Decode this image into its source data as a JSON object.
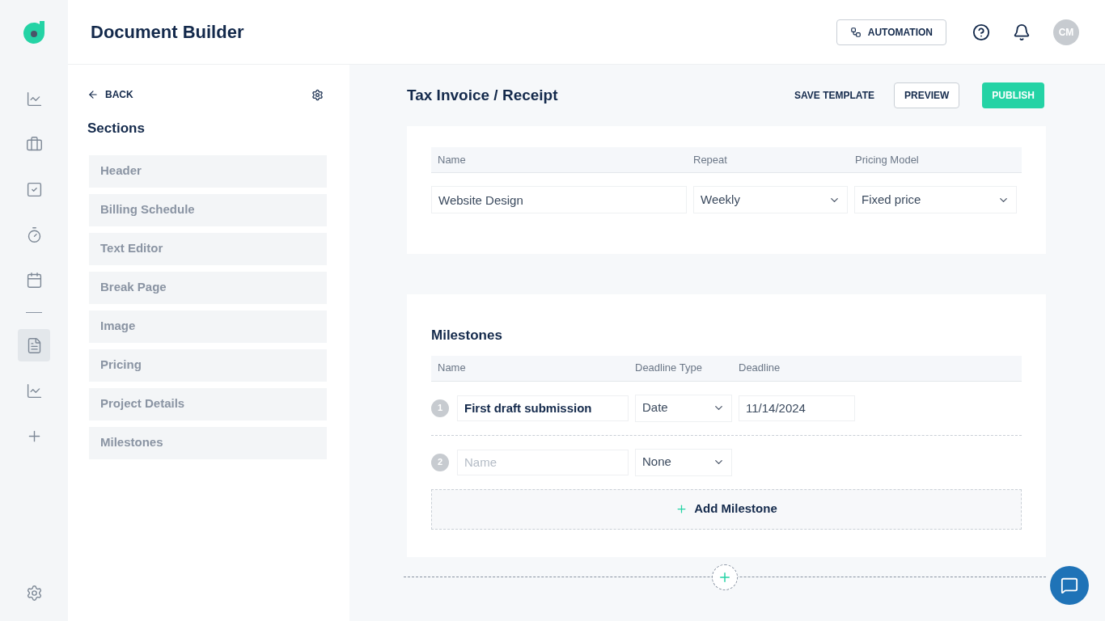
{
  "app": {
    "title": "Document Builder"
  },
  "nav": [
    {
      "kind": "chart",
      "selected": false
    },
    {
      "kind": "briefcase",
      "selected": false
    },
    {
      "kind": "checklist",
      "selected": false
    },
    {
      "kind": "timer",
      "selected": false
    },
    {
      "kind": "calendar",
      "selected": false
    },
    {
      "kind": "divider"
    },
    {
      "kind": "document",
      "selected": true
    },
    {
      "kind": "chart",
      "selected": false
    },
    {
      "kind": "plus",
      "selected": false
    }
  ],
  "header": {
    "automation": "AUTOMATION",
    "avatar": "CM"
  },
  "sections_panel": {
    "back": "BACK",
    "title": "Sections",
    "items": [
      "Header",
      "Billing Schedule",
      "Text Editor",
      "Break Page",
      "Image",
      "Pricing",
      "Project Details",
      "Milestones"
    ]
  },
  "editor": {
    "title": "Tax Invoice / Receipt",
    "save": "SAVE TEMPLATE",
    "preview": "PREVIEW",
    "publish": "PUBLISH"
  },
  "project_table": {
    "columns": [
      "Name",
      "Repeat",
      "Pricing Model"
    ],
    "name": "Website Design",
    "repeat": "Weekly",
    "pricing": "Fixed price"
  },
  "milestones": {
    "title": "Milestones",
    "columns": [
      "Name",
      "Deadline Type",
      "Deadline"
    ],
    "rows": [
      {
        "number": "1",
        "name": "First draft submission",
        "deadline_type": "Date",
        "deadline": "11/14/2024"
      },
      {
        "number": "2",
        "placeholder": "Name",
        "deadline_type": "None"
      }
    ],
    "add": "Add Milestone"
  }
}
